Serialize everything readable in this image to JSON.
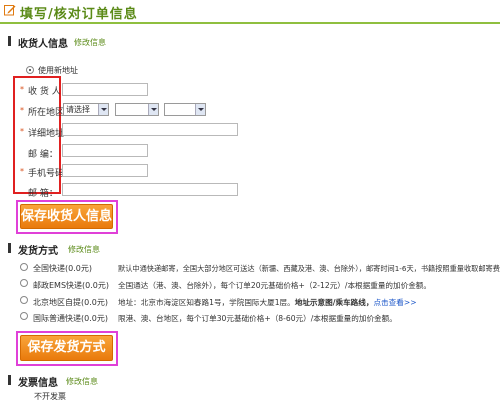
{
  "header": {
    "title": "填写/核对订单信息"
  },
  "consignee": {
    "title": "收货人信息",
    "edit": "修改信息",
    "use_new": "使用新地址",
    "labels": {
      "name": "收 货 人：",
      "region": "所在地区：",
      "address": "详细地址：",
      "postcode": "邮    编：",
      "phone": "手机号码：",
      "email": "邮    箱："
    },
    "region_select": "请选择",
    "save": "保存收货人信息"
  },
  "delivery": {
    "title": "发货方式",
    "edit": "修改信息",
    "options": [
      {
        "label": "全国快递(0.0元)",
        "desc": "默认中通快递邮寄，全国大部分地区可送达（新疆、西藏及港、澳、台除外），邮寄时间1-6天，书籍按照重量收取邮寄费。"
      },
      {
        "label": "邮政EMS快递(0.0元)",
        "desc": "全国通达（港、澳、台除外），每个订单20元基础价格+（2-12元）/本根据重量的加价金额。"
      },
      {
        "label": "北京地区自提(0.0元)",
        "desc_prefix": "地址：北京市海淀区知春路1号，学院国际大厦1层。",
        "desc_bold": "地址示意图/乘车路线，",
        "desc_link": "点击查看>>"
      },
      {
        "label": "国际普通快递(0.0元)",
        "desc": "限港、澳、台地区，每个订单30元基础价格+（8-60元）/本根据重量的加价金额。"
      }
    ],
    "save": "保存发货方式"
  },
  "invoice": {
    "title": "发票信息",
    "edit": "修改信息",
    "value": "不开发票"
  }
}
